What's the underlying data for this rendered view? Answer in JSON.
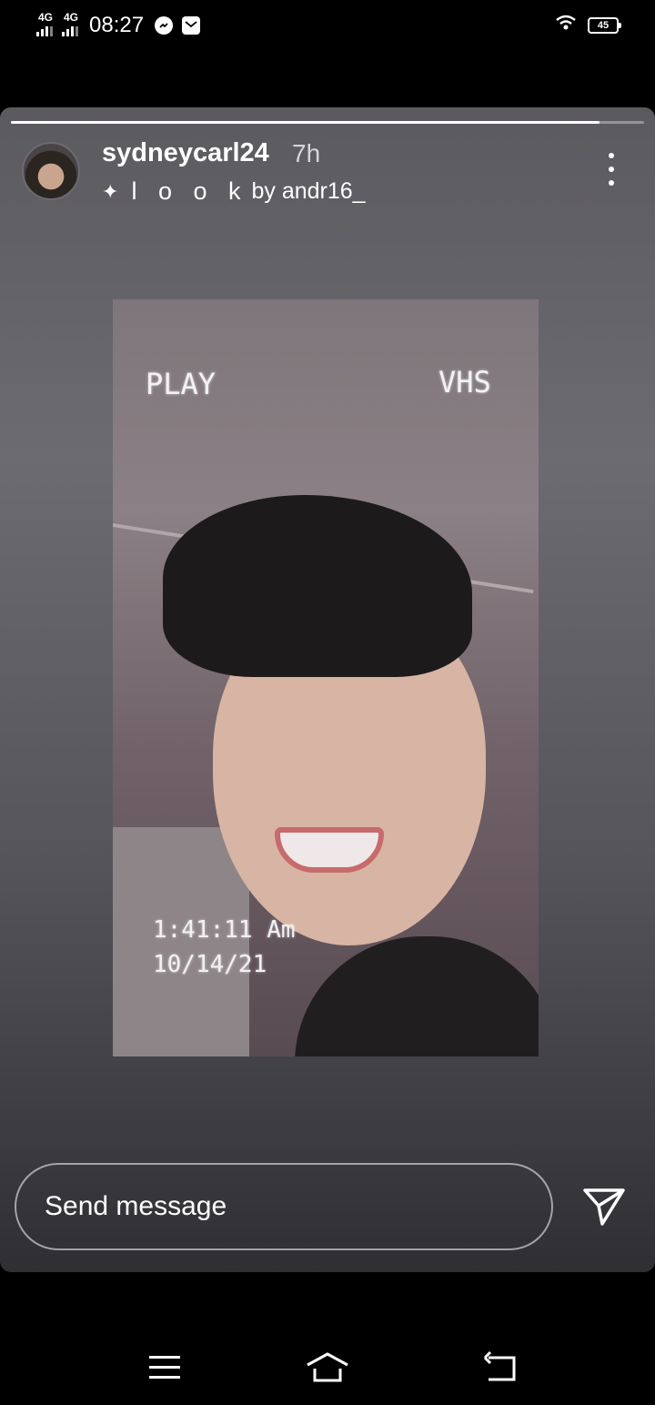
{
  "status_bar": {
    "network_1": "4G",
    "network_2": "4G",
    "time": "08:27",
    "icons": [
      "messenger-icon",
      "mail-icon",
      "wifi-icon"
    ],
    "battery": "45"
  },
  "story": {
    "progress": 0.93,
    "username": "sydneycarl24",
    "time_ago": "7h",
    "effect": {
      "name": "l o o k",
      "by_text": "by andr16_"
    },
    "photo_overlay": {
      "play_text": "PLAY",
      "vhs_text": "VHS",
      "time_text": "1:41:11 Am",
      "date_text": "10/14/21"
    },
    "reply": {
      "placeholder": "Send message"
    }
  },
  "colors": {
    "background": "#000000",
    "story_gradient_top": "#5b5a5f",
    "story_gradient_bottom": "#2f2f33"
  }
}
